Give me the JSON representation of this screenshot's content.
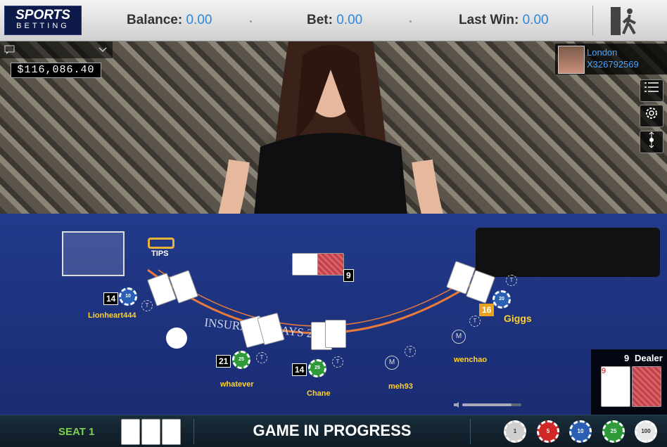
{
  "header": {
    "logo_top": "SPORTS",
    "logo_bottom": "BETTING",
    "balance_label": "Balance:",
    "balance_value": "0.00",
    "bet_label": "Bet:",
    "bet_value": "0.00",
    "lastwin_label": "Last Win:",
    "lastwin_value": "0.00",
    "exit_icon": "exit-door-icon"
  },
  "left_panel": {
    "chat_icon": "chat-icon",
    "balance_display": "$116,086.40"
  },
  "user": {
    "location": "London",
    "id": "X326792569"
  },
  "side_buttons": [
    "menu-list-icon",
    "settings-gear-icon",
    "camera-zoom-icon"
  ],
  "table": {
    "tips_label": "TIPS",
    "dealer_total": "9",
    "players": [
      {
        "name": "Lionheart444",
        "total": "14",
        "chip": "10"
      },
      {
        "name": "whatever",
        "total": "21",
        "chip": "25"
      },
      {
        "name": "Chane",
        "total": "14",
        "chip": "25"
      },
      {
        "name": "meh93",
        "total": "",
        "chip": ""
      },
      {
        "name": "wenchao",
        "total": "",
        "chip": ""
      },
      {
        "name": "Giggs",
        "total": "16",
        "chip": "20"
      }
    ],
    "tcircle": "T",
    "mcircle": "M",
    "table_text": "INSURANCE PAYS 2 TO 1"
  },
  "dealer_panel": {
    "total": "9",
    "label": "Dealer"
  },
  "bottom": {
    "seat_label": "SEAT 1",
    "status": "GAME IN PROGRESS",
    "chips": [
      {
        "value": "1",
        "color": "#cfcfcf",
        "text": "#333"
      },
      {
        "value": "5",
        "color": "#d12727",
        "text": "#fff"
      },
      {
        "value": "10",
        "color": "#2a5fb3",
        "text": "#fff"
      },
      {
        "value": "25",
        "color": "#2e9a3a",
        "text": "#fff"
      },
      {
        "value": "100",
        "color": "#e8e8e8",
        "text": "#333"
      }
    ]
  }
}
